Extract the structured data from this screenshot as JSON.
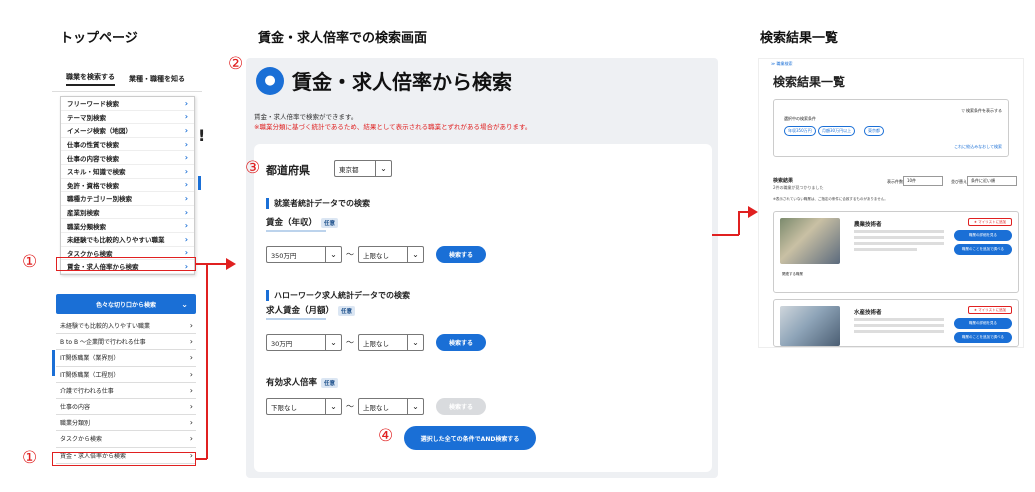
{
  "headings": {
    "top_page": "トップページ",
    "search_screen": "賃金・求人倍率での検索画面",
    "results": "検索結果一覧"
  },
  "markers": {
    "m1": "①",
    "m2": "②",
    "m3": "③",
    "m4": "④"
  },
  "top_page": {
    "nav": [
      "職業を検索する",
      "業種・職種を知る"
    ],
    "exclaim": "!",
    "menu_items": [
      "フリーワード検索",
      "テーマ別検索",
      "イメージ検索（地図）",
      "仕事の性質で検索",
      "仕事の内容で検索",
      "スキル・知識で検索",
      "免許・資格で検索",
      "職種カテゴリー別検索",
      "産業別検索",
      "職業分類検索",
      "未経験でも比較的入りやすい職業",
      "タスクから検索",
      "賃金・求人倍率から検索"
    ],
    "chevron": "›",
    "mobile_button": "色々な切り口から検索",
    "mobile_items": [
      "未経験でも比較的入りやすい職業",
      "B to B ～企業間で行われる仕事",
      "IT関係職業（業界別）",
      "IT関係職業（工程別）",
      "介護で行われる仕事",
      "仕事の内容",
      "職業分類別",
      "タスクから検索",
      "賃金・求人倍率から検索"
    ]
  },
  "search": {
    "icon": "coin-bag-icon",
    "title": "賃金・求人倍率から検索",
    "description": "賃金・求人倍率で検索ができます。",
    "warning": "※職業分類に基づく統計であるため、結果として表示される職業とずれがある場合があります。",
    "prefecture_label": "都道府県",
    "prefecture_value": "東京都",
    "section1": "就業者統計データでの検索",
    "annual_wage_label": "賃金（年収）",
    "optional_tag": "任意",
    "annual_min": "350万円",
    "annual_max": "上限なし",
    "tilde": "～",
    "search_label": "検索する",
    "section2": "ハローワーク求人統計データでの検索",
    "monthly_wage_label": "求人賃金（月額）",
    "monthly_min": "30万円",
    "monthly_max": "上限なし",
    "ratio_label": "有効求人倍率",
    "ratio_min": "下限なし",
    "ratio_max": "上限なし",
    "and_search": "選択した全ての条件でAND検索する"
  },
  "results": {
    "breadcrumb": "≫ 職業検索",
    "title": "検索結果一覧",
    "cond_toggle": "▽ 検索条件を表示する",
    "cond_label": "選択中の検索条件",
    "chips": [
      "年収350万円",
      "月額30万円以上",
      "東京都"
    ],
    "cond_link": "これに絞込みなおして検索",
    "result_label": "検索結果",
    "result_count": "2件の職業が見つかりました",
    "sort_label": "並び替え",
    "sort_value": "条件に近い順",
    "display_label": "表示件数",
    "display_value": "10件",
    "note": "※表示されていない職業は、ご指定の条件に合致するものがありません。",
    "jobs": [
      {
        "name": "農業技術者",
        "fav": "★ マイリストに追加",
        "btn1": "職業の詳細を見る",
        "btn2": "職業のことを追加で調べる",
        "sub": "関連する職業"
      },
      {
        "name": "水産技術者",
        "fav": "★ マイリストに追加",
        "btn1": "職業の詳細を見る",
        "btn2": "職業のことを追加で調べる"
      }
    ]
  }
}
